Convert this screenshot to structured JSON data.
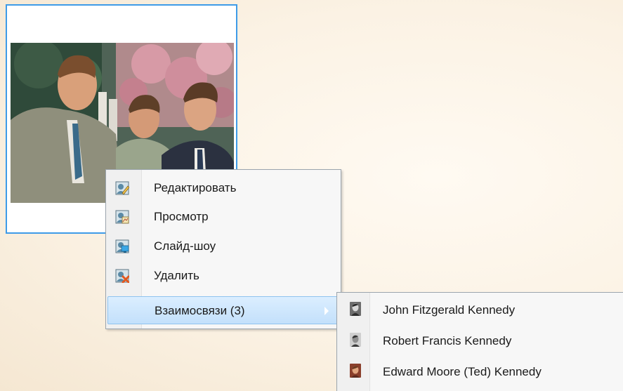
{
  "photo_card": {
    "selected": true,
    "accent_color": "#3e9be8"
  },
  "context_menu": {
    "items": [
      {
        "label": "Редактировать",
        "icon": "edit-person-icon"
      },
      {
        "label": "Просмотр",
        "icon": "view-person-icon"
      },
      {
        "label": "Слайд-шоу",
        "icon": "slideshow-person-icon"
      },
      {
        "label": "Удалить",
        "icon": "delete-person-icon"
      },
      {
        "label": "Взаимосвязи (3)",
        "icon": "",
        "has_submenu": true,
        "highlighted": true
      }
    ]
  },
  "relations_submenu": {
    "items": [
      {
        "label": "John Fitzgerald Kennedy",
        "icon": "portrait-icon"
      },
      {
        "label": "Robert Francis Kennedy",
        "icon": "portrait-icon"
      },
      {
        "label": "Edward Moore (Ted) Kennedy",
        "icon": "portrait-icon"
      }
    ]
  },
  "colors": {
    "menu_highlight": "#c3e0fb",
    "menu_border": "#9aa4ad",
    "background": "#fbf2e4"
  }
}
